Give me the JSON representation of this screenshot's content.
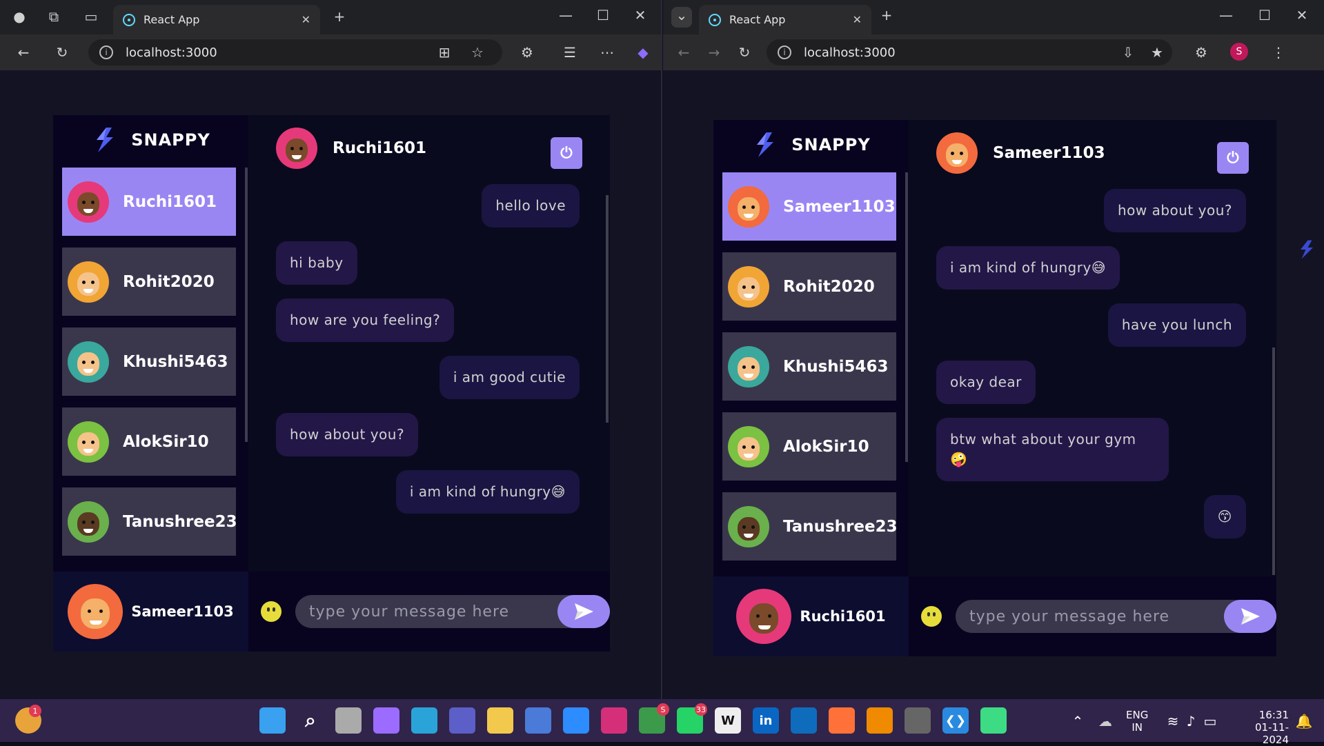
{
  "left_window": {
    "tab_title": "React App",
    "url": "localhost:3000",
    "app": {
      "brand": "SNAPPY",
      "contacts": [
        {
          "name": "Ruchi1601",
          "active": true
        },
        {
          "name": "Rohit2020",
          "active": false
        },
        {
          "name": "Khushi5463",
          "active": false
        },
        {
          "name": "AlokSir10",
          "active": false
        },
        {
          "name": "Tanushree23",
          "active": false
        }
      ],
      "current_user": "Sameer1103",
      "chat_with": "Ruchi1601",
      "messages": [
        {
          "type": "sent",
          "text": "hello love"
        },
        {
          "type": "recv",
          "text": "hi baby"
        },
        {
          "type": "recv",
          "text": "how are you feeling?"
        },
        {
          "type": "sent",
          "text": "i am good cutie"
        },
        {
          "type": "recv",
          "text": "how about you?"
        },
        {
          "type": "sent",
          "text": "i am kind of hungry😅"
        }
      ],
      "input_placeholder": "type your message here"
    }
  },
  "right_window": {
    "tab_title": "React App",
    "url": "localhost:3000",
    "profile_initial": "S",
    "app": {
      "brand": "SNAPPY",
      "contacts": [
        {
          "name": "Sameer1103",
          "active": true
        },
        {
          "name": "Rohit2020",
          "active": false
        },
        {
          "name": "Khushi5463",
          "active": false
        },
        {
          "name": "AlokSir10",
          "active": false
        },
        {
          "name": "Tanushree23",
          "active": false
        }
      ],
      "current_user": "Ruchi1601",
      "chat_with": "Sameer1103",
      "messages": [
        {
          "type": "sent",
          "text": "how about you?"
        },
        {
          "type": "recv",
          "text": "i am kind of hungry😅"
        },
        {
          "type": "sent",
          "text": "have you lunch"
        },
        {
          "type": "recv",
          "text": "okay dear"
        },
        {
          "type": "recv",
          "text": "btw what about your gym 🤪"
        },
        {
          "type": "sent",
          "text": "😙"
        }
      ],
      "input_placeholder": "type your message here"
    }
  },
  "taskbar": {
    "language": "ENG",
    "region": "IN",
    "time": "16:31",
    "date": "01-11-2024",
    "weather_badge": "1",
    "chrome_badge": "S",
    "whatsapp_badge": "33",
    "apps": [
      "start-icon",
      "search-icon",
      "task-view-icon",
      "copilot-icon",
      "edge-icon",
      "teams-icon",
      "file-explorer-icon",
      "store-icon",
      "zoom-icon",
      "instagram-icon",
      "chrome-icon",
      "whatsapp-icon",
      "wikipedia-icon",
      "linkedin-icon",
      "outlook-icon",
      "firefox-icon",
      "vlc-icon",
      "davinci-icon",
      "vscode-icon",
      "android-icon"
    ]
  }
}
